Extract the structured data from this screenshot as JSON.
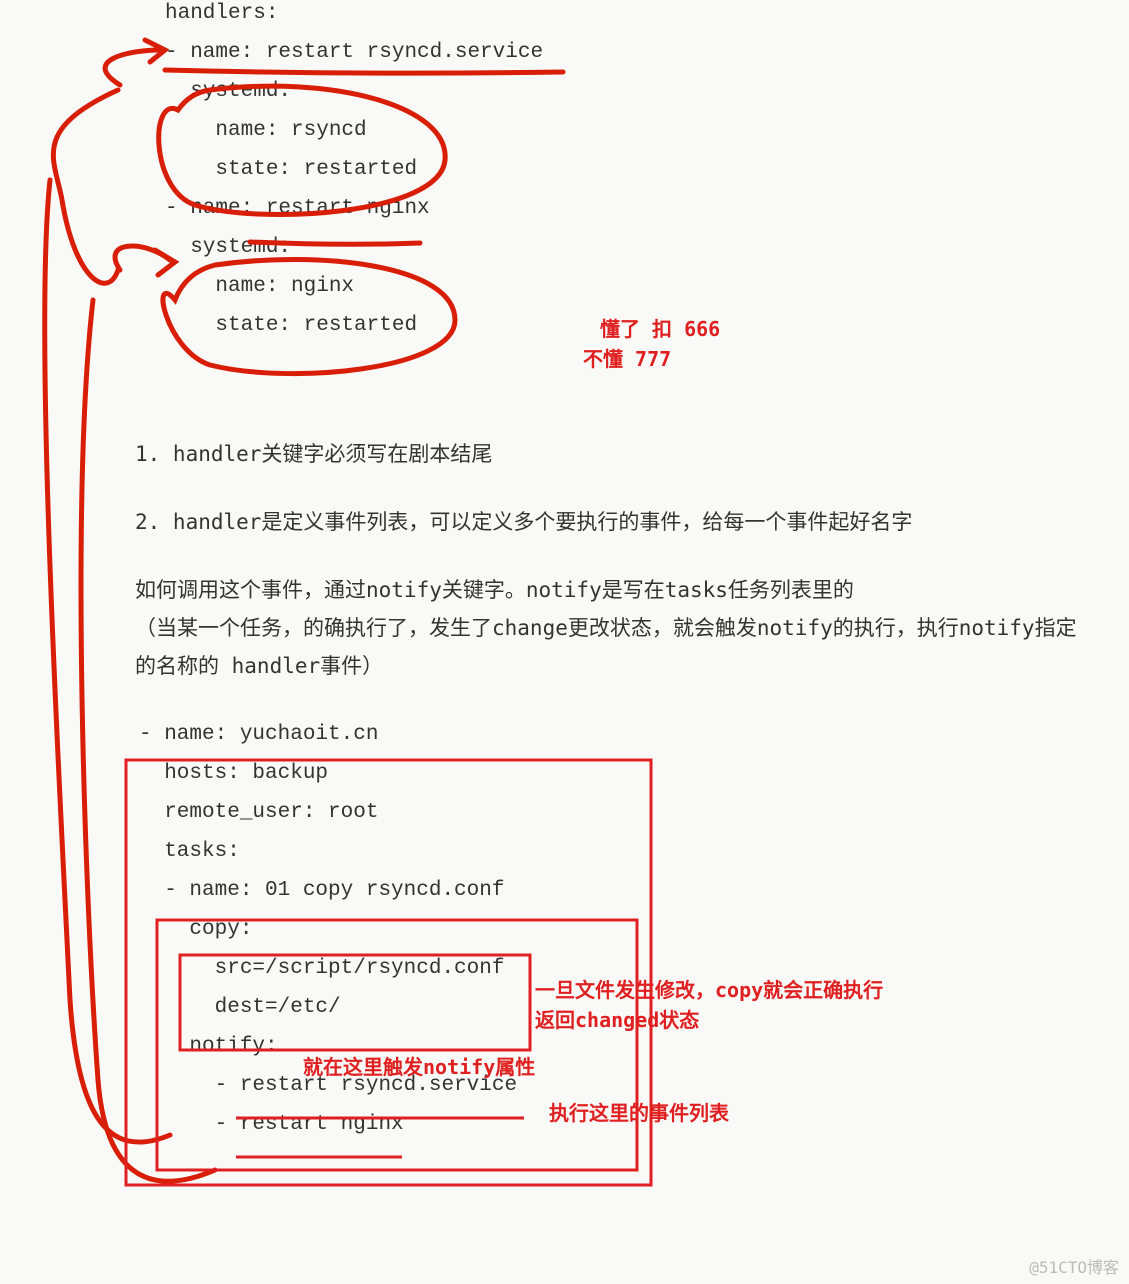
{
  "code_top": {
    "l1": "handlers:",
    "l2": "- name: restart rsyncd.service",
    "l3": "  systemd:",
    "l4": "    name: rsyncd",
    "l5": "    state: restarted",
    "l6": "- name: restart nginx",
    "l7": "  systemd:",
    "l8": "    name: nginx",
    "l9": "    state: restarted"
  },
  "annotations": {
    "line1_top": "懂了 扣 666",
    "line2_top": "不懂 777",
    "copy_note": "一旦文件发生修改，copy就会正确执行",
    "copy_note2": "返回changed状态",
    "notify_note": "就在这里触发notify属性",
    "events_note": "执行这里的事件列表"
  },
  "paragraphs": {
    "p1": "1.  handler关键字必须写在剧本结尾",
    "p2": "2.  handler是定义事件列表，可以定义多个要执行的事件，给每一个事件起好名字",
    "p3a": "如何调用这个事件，通过notify关键字。notify是写在tasks任务列表里的",
    "p3b": "（当某一个任务，的确执行了，发生了change更改状态，就会触发notify的执行，执行notify指定的名称的 handler事件）"
  },
  "code_bottom": {
    "l1": "- name: yuchaoit.cn",
    "l2": "  hosts: backup",
    "l3": "  remote_user: root",
    "l4": "  tasks:",
    "l5": "  - name: 01 copy rsyncd.conf",
    "l6": "    copy:",
    "l7": "      src=/script/rsyncd.conf",
    "l8": "      dest=/etc/",
    "l9": "    notify:",
    "l10": "      - restart rsyncd.service",
    "l11": "      - restart nginx"
  },
  "watermark": "@51CTO博客"
}
